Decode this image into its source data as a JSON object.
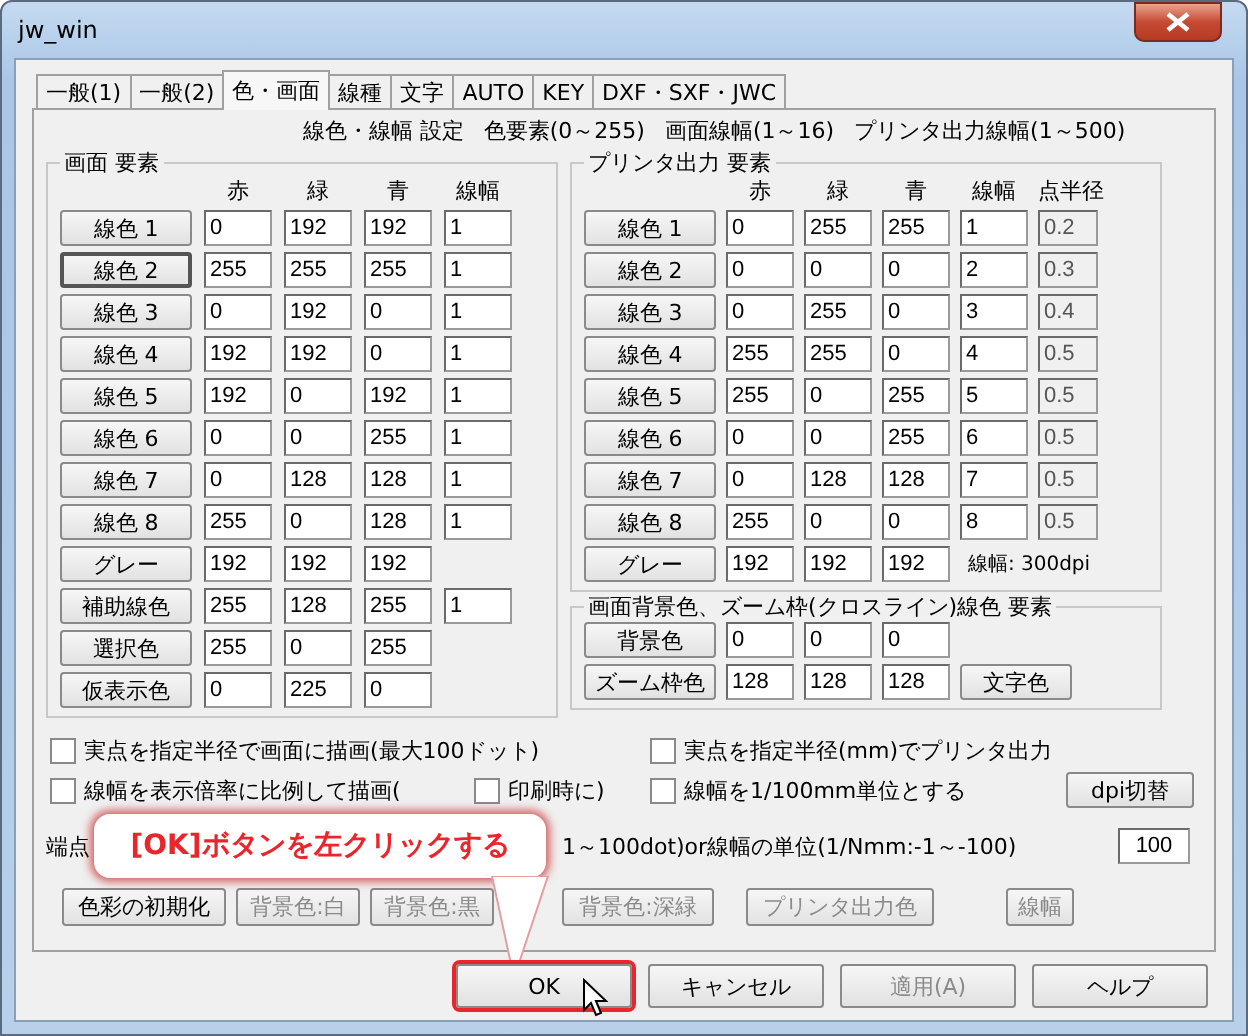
{
  "window": {
    "title": "jw_win"
  },
  "tabs": [
    {
      "label": "一般(1)",
      "selected": false
    },
    {
      "label": "一般(2)",
      "selected": false
    },
    {
      "label": "色・画面",
      "selected": true
    },
    {
      "label": "線種",
      "selected": false
    },
    {
      "label": "文字",
      "selected": false
    },
    {
      "label": "AUTO",
      "selected": false
    },
    {
      "label": "KEY",
      "selected": false
    },
    {
      "label": "DXF・SXF・JWC",
      "selected": false
    }
  ],
  "heading": [
    "線色・線幅 設定",
    "色要素(0～255)",
    "画面線幅(1～16)",
    "プリンタ出力線幅(1～500)"
  ],
  "screen_group": {
    "title": "画面 要素",
    "columns": [
      "赤",
      "緑",
      "青",
      "線幅"
    ],
    "rows": [
      {
        "label": "線色 1",
        "focused": false,
        "values": [
          "0",
          "192",
          "192",
          "1"
        ]
      },
      {
        "label": "線色 2",
        "focused": true,
        "values": [
          "255",
          "255",
          "255",
          "1"
        ]
      },
      {
        "label": "線色 3",
        "focused": false,
        "values": [
          "0",
          "192",
          "0",
          "1"
        ]
      },
      {
        "label": "線色 4",
        "focused": false,
        "values": [
          "192",
          "192",
          "0",
          "1"
        ]
      },
      {
        "label": "線色 5",
        "focused": false,
        "values": [
          "192",
          "0",
          "192",
          "1"
        ]
      },
      {
        "label": "線色 6",
        "focused": false,
        "values": [
          "0",
          "0",
          "255",
          "1"
        ]
      },
      {
        "label": "線色 7",
        "focused": false,
        "values": [
          "0",
          "128",
          "128",
          "1"
        ]
      },
      {
        "label": "線色 8",
        "focused": false,
        "values": [
          "255",
          "0",
          "128",
          "1"
        ]
      },
      {
        "label": "グレー",
        "focused": false,
        "values": [
          "192",
          "192",
          "192"
        ]
      },
      {
        "label": "補助線色",
        "focused": false,
        "values": [
          "255",
          "128",
          "255",
          "1"
        ]
      },
      {
        "label": "選択色",
        "focused": false,
        "values": [
          "255",
          "0",
          "255"
        ]
      },
      {
        "label": "仮表示色",
        "focused": false,
        "values": [
          "0",
          "225",
          "0"
        ]
      }
    ]
  },
  "printer_group": {
    "title": "プリンタ出力 要素",
    "columns": [
      "赤",
      "緑",
      "青",
      "線幅",
      "点半径"
    ],
    "rows": [
      {
        "label": "線色 1",
        "values": [
          "0",
          "255",
          "255",
          "1"
        ],
        "point_radius": {
          "value": "0.2",
          "disabled": true
        }
      },
      {
        "label": "線色 2",
        "values": [
          "0",
          "0",
          "0",
          "2"
        ],
        "point_radius": {
          "value": "0.3",
          "disabled": true
        }
      },
      {
        "label": "線色 3",
        "values": [
          "0",
          "255",
          "0",
          "3"
        ],
        "point_radius": {
          "value": "0.4",
          "disabled": true
        }
      },
      {
        "label": "線色 4",
        "values": [
          "255",
          "255",
          "0",
          "4"
        ],
        "point_radius": {
          "value": "0.5",
          "disabled": true
        }
      },
      {
        "label": "線色 5",
        "values": [
          "255",
          "0",
          "255",
          "5"
        ],
        "point_radius": {
          "value": "0.5",
          "disabled": true
        }
      },
      {
        "label": "線色 6",
        "values": [
          "0",
          "0",
          "255",
          "6"
        ],
        "point_radius": {
          "value": "0.5",
          "disabled": true
        }
      },
      {
        "label": "線色 7",
        "values": [
          "0",
          "128",
          "128",
          "7"
        ],
        "point_radius": {
          "value": "0.5",
          "disabled": true
        }
      },
      {
        "label": "線色 8",
        "values": [
          "255",
          "0",
          "0",
          "8"
        ],
        "point_radius": {
          "value": "0.5",
          "disabled": true
        }
      },
      {
        "label": "グレー",
        "values": [
          "192",
          "192",
          "192"
        ]
      }
    ],
    "resolution_label": "線幅: 300dpi"
  },
  "background_group": {
    "title": "画面背景色、ズーム枠(クロスライン)線色 要素",
    "rows": [
      {
        "label": "背景色",
        "values": [
          "0",
          "0",
          "0"
        ]
      },
      {
        "label": "ズーム枠色",
        "values": [
          "128",
          "128",
          "128"
        ]
      }
    ],
    "button": "文字色"
  },
  "options": [
    [
      {
        "label": "実点を指定半径で画面に描画(最大100ドット)",
        "checked": false
      },
      {
        "label": "実点を指定半径(mm)でプリンタ出力",
        "checked": false
      }
    ],
    [
      {
        "label": "線幅を表示倍率に比例して描画(",
        "checked": false
      },
      {
        "label": "印刷時に)",
        "checked": false
      },
      {
        "label": "線幅を1/100mm単位とする",
        "checked": false
      }
    ]
  ],
  "dpi_button": "dpi切替",
  "unit_row": {
    "prefix": "端点",
    "label": "1～100dot)or線幅の単位(1/Nmm:-1～-100)",
    "value": "100"
  },
  "action_buttons": [
    {
      "label": "色彩の初期化",
      "disabled": false
    },
    {
      "label": "背景色:白",
      "disabled": true
    },
    {
      "label": "背景色:黒",
      "disabled": true
    },
    {
      "label": "背景色:深緑",
      "disabled": true
    },
    {
      "label": "プリンタ出力色",
      "disabled": true
    },
    {
      "label": "線幅",
      "disabled": true
    }
  ],
  "callout": {
    "text": "[OK]ボタンを左クリックする"
  },
  "footer_buttons": [
    {
      "label": "OK",
      "disabled": false,
      "highlighted": true
    },
    {
      "label": "キャンセル",
      "disabled": false,
      "highlighted": false
    },
    {
      "label": "適用(A)",
      "disabled": true,
      "highlighted": false
    },
    {
      "label": "ヘルプ",
      "disabled": false,
      "highlighted": false
    }
  ]
}
